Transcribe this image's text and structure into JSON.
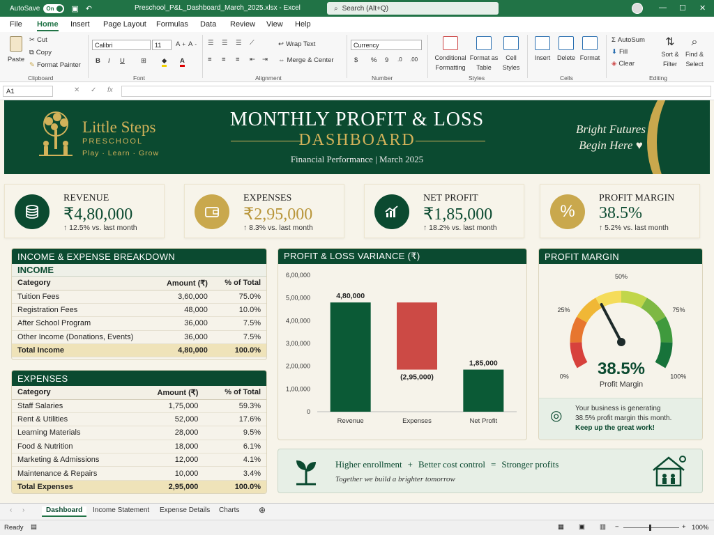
{
  "titlebar": {
    "autosave_label": "AutoSave",
    "autosave_state": "On",
    "doc_title": "Preschool_P&L_Dashboard_March_2025.xlsx  -  Excel",
    "search_placeholder": "Search (Alt+Q)"
  },
  "menu": [
    "File",
    "Home",
    "Insert",
    "Page Layout",
    "Formulas",
    "Data",
    "Review",
    "View",
    "Help"
  ],
  "ribbon": {
    "paste": "Paste",
    "cut": "Cut",
    "copy": "Copy",
    "format_painter": "Format Painter",
    "clipboard": "Clipboard",
    "font_name": "Calibri",
    "font_size": "11",
    "font_group": "Font",
    "wrap_text": "Wrap Text",
    "merge_center": "Merge & Center",
    "alignment": "Alignment",
    "number_format": "Currency",
    "number": "Number",
    "conditional_formatting": [
      "Conditional",
      "Formatting"
    ],
    "format_as_table": [
      "Format as",
      "Table"
    ],
    "cell_styles": [
      "Cell",
      "Styles"
    ],
    "styles": "Styles",
    "insert": "Insert",
    "delete": "Delete",
    "format": "Format",
    "cells": "Cells",
    "autosum": "AutoSum",
    "fill": "Fill",
    "clear": "Clear",
    "sort_filter": [
      "Sort &",
      "Filter"
    ],
    "find_select": [
      "Find &",
      "Select"
    ],
    "editing": "Editing"
  },
  "formula_bar": {
    "name_box": "A1",
    "fx": "fx"
  },
  "banner": {
    "brand_name": "Little Steps",
    "brand_sub": "PRESCHOOL",
    "brand_tagline": "Play  ·  Learn  ·  Grow",
    "title_line1": "MONTHLY PROFIT & LOSS",
    "title_line2": "DASHBOARD",
    "subtitle": "Financial Performance   |   March 2025",
    "slogan_line1": "Bright Futures",
    "slogan_line2": "Begin Here ♥"
  },
  "kpis": [
    {
      "label": "REVENUE",
      "value": "₹4,80,000",
      "change": "↑ 12.5% vs. last month",
      "icon": "coins-icon",
      "color": "#0b4a30"
    },
    {
      "label": "EXPENSES",
      "value": "₹2,95,000",
      "change": "↑ 8.3% vs. last month",
      "icon": "wallet-icon",
      "color": "#c9a84d"
    },
    {
      "label": "NET PROFIT",
      "value": "₹1,85,000",
      "change": "↑ 18.2% vs. last month",
      "icon": "growth-chart-icon",
      "color": "#0b4a30"
    },
    {
      "label": "PROFIT MARGIN",
      "value": "38.5%",
      "change": "↑ 5.2% vs. last month",
      "icon": "percent-icon",
      "color": "#c9a84d"
    }
  ],
  "breakdown": {
    "title": "INCOME & EXPENSE BREAKDOWN",
    "income_title": "INCOME",
    "columns": [
      "Category",
      "Amount (₹)",
      "% of Total"
    ],
    "income_rows": [
      [
        "Tuition Fees",
        "3,60,000",
        "75.0%"
      ],
      [
        "Registration Fees",
        "48,000",
        "10.0%"
      ],
      [
        "After School Program",
        "36,000",
        "7.5%"
      ],
      [
        "Other Income (Donations, Events)",
        "36,000",
        "7.5%"
      ]
    ],
    "income_total": [
      "Total Income",
      "4,80,000",
      "100.0%"
    ],
    "expenses_title": "EXPENSES",
    "expense_rows": [
      [
        "Staff Salaries",
        "1,75,000",
        "59.3%"
      ],
      [
        "Rent & Utilities",
        "52,000",
        "17.6%"
      ],
      [
        "Learning Materials",
        "28,000",
        "9.5%"
      ],
      [
        "Food & Nutrition",
        "18,000",
        "6.1%"
      ],
      [
        "Marketing & Admissions",
        "12,000",
        "4.1%"
      ],
      [
        "Maintenance & Repairs",
        "10,000",
        "3.4%"
      ]
    ],
    "expense_total": [
      "Total Expenses",
      "2,95,000",
      "100.0%"
    ]
  },
  "variance_title": "PROFIT & LOSS VARIANCE (₹)",
  "chart_data": {
    "type": "bar",
    "title": "PROFIT & LOSS VARIANCE (₹)",
    "categories": [
      "Revenue",
      "Expenses",
      "Net Profit"
    ],
    "values": [
      480000,
      -295000,
      185000
    ],
    "bar_labels": [
      "4,80,000",
      "(2,95,000)",
      "1,85,000"
    ],
    "bar_ranges": [
      [
        0,
        480000
      ],
      [
        185000,
        480000
      ],
      [
        0,
        185000
      ]
    ],
    "colors": [
      "#0b5a36",
      "#cc4a45",
      "#0b5a36"
    ],
    "yticks": [
      0,
      100000,
      200000,
      300000,
      400000,
      500000,
      600000
    ],
    "ytick_labels": [
      "0",
      "1,00,000",
      "2,00,000",
      "3,00,000",
      "4,00,000",
      "5,00,000",
      "6,00,000"
    ],
    "ylim": [
      0,
      600000
    ],
    "grid": false
  },
  "gauge": {
    "title": "PROFIT MARGIN",
    "value": 38.5,
    "value_text": "38.5%",
    "caption": "Profit Margin",
    "ticks": [
      "0%",
      "25%",
      "50%",
      "75%",
      "100%"
    ],
    "message_line1": "Your business is generating",
    "message_line2": "38.5% profit margin this month.",
    "message_line3": "Keep up the great work!"
  },
  "note": {
    "equation": [
      "Higher enrollment",
      "+",
      "Better cost control",
      "=",
      "Stronger profits"
    ],
    "tagline": "Together we build a brighter tomorrow"
  },
  "tabs": [
    "Dashboard",
    "Income Statement",
    "Expense Details",
    "Charts"
  ],
  "status": {
    "ready": "Ready",
    "zoom": "100%"
  }
}
